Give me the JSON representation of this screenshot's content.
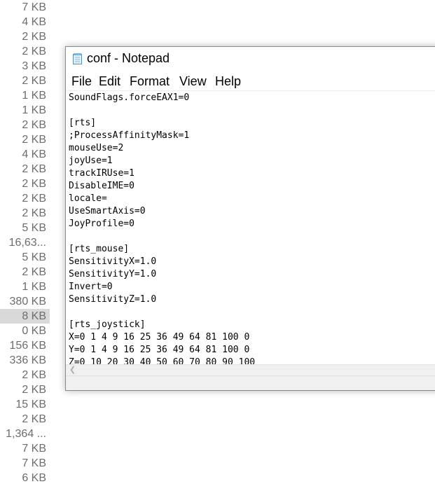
{
  "explorer": {
    "sizes": [
      "7 KB",
      "4 KB",
      "2 KB",
      "2 KB",
      "3 KB",
      "2 KB",
      "1 KB",
      "1 KB",
      "2 KB",
      "2 KB",
      "4 KB",
      "2 KB",
      "2 KB",
      "2 KB",
      "2 KB",
      "5 KB",
      "16,63...",
      "5 KB",
      "2 KB",
      "1 KB",
      "380 KB",
      "8 KB",
      "0 KB",
      "156 KB",
      "336 KB",
      "2 KB",
      "2 KB",
      "15 KB",
      "2 KB",
      "1,364 ...",
      "7 KB",
      "7 KB",
      "6 KB"
    ],
    "selected_index": 21
  },
  "notepad": {
    "title": "conf - Notepad",
    "menu": {
      "file": "File",
      "edit": "Edit",
      "format": "Format",
      "view": "View",
      "help": "Help"
    },
    "lines": [
      "SoundFlags.forceEAX1=0",
      "",
      "[rts]",
      ";ProcessAffinityMask=1",
      "mouseUse=2",
      "joyUse=1",
      "trackIRUse=1",
      "DisableIME=0",
      "locale=",
      "UseSmartAxis=0",
      "JoyProfile=0",
      "",
      "[rts_mouse]",
      "SensitivityX=1.0",
      "SensitivityY=1.0",
      "Invert=0",
      "SensitivityZ=1.0",
      "",
      "[rts_joystick]",
      "X=0 1 4 9 16 25 36 49 64 81 100 0",
      "Y=0 1 4 9 16 25 36 49 64 81 100 0",
      "Z=0 10 20 30 40 50 60 70 80 90 100"
    ]
  },
  "icons": {
    "notepad": "notepad-icon",
    "scroll_left": "chevron-left-icon"
  },
  "colors": {
    "size_text": "#6d6d6d",
    "selected_row": "#d9d9d9",
    "chrome": "#f0f0f0"
  }
}
